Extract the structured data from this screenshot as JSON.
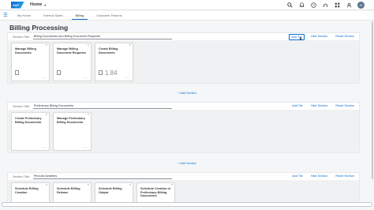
{
  "shell": {
    "logo_text": "SAP",
    "home_label": "Home",
    "avatar_initials": "JD",
    "icons": [
      "search-icon",
      "bell-icon",
      "help-icon",
      "headset-icon",
      "apps-icon",
      "user-icon"
    ]
  },
  "tabs": [
    {
      "label": "My Home",
      "active": false
    },
    {
      "label": "Internal Sales",
      "active": false
    },
    {
      "label": "Billing",
      "active": true
    },
    {
      "label": "Customer Returns",
      "active": false
    }
  ],
  "page": {
    "title": "Billing Processing"
  },
  "section_title_label": "Section Title:",
  "section_actions": {
    "add_tile": "Add Tile",
    "hide_section": "Hide Section",
    "reset_section": "Reset Section"
  },
  "add_section_label": "+ Add Section",
  "sections": [
    {
      "title": "Billing Documents and Billing Document Requests",
      "tiles": [
        {
          "title": "Manage Billing Documents",
          "number": ""
        },
        {
          "title": "Manage Billing Document Requests",
          "number": ""
        },
        {
          "title": "Create Billing Documents",
          "number": "1.84"
        }
      ]
    },
    {
      "title": "Preliminary Billing Documents",
      "tiles": [
        {
          "title": "Create Preliminary Billing Documents",
          "number": ""
        },
        {
          "title": "Manage Preliminary Billing Documents",
          "number": ""
        }
      ]
    },
    {
      "title": "Periodic Activities",
      "tiles": [
        {
          "title": "Schedule Billing Creation",
          "number": ""
        },
        {
          "title": "Schedule Billing Release",
          "number": ""
        },
        {
          "title": "Schedule Billing Output",
          "number": ""
        },
        {
          "title": "Schedule Creation of Preliminary Billing Documents",
          "number": ""
        }
      ]
    }
  ]
}
